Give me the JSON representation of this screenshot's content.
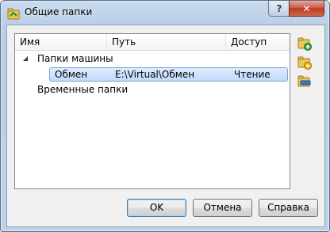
{
  "window": {
    "title": "Общие папки",
    "help_glyph": "?",
    "close_glyph": "✕",
    "title_icon": "shared-folders-icon"
  },
  "list": {
    "columns": [
      "Имя",
      "Путь",
      "Доступ"
    ],
    "group_machine": "Папки машины",
    "expander_glyph": "◢",
    "row": {
      "name": "Обмен",
      "path": "E:\\Virtual\\Обмен",
      "access": "Чтение"
    },
    "group_temp": "Временные папки"
  },
  "side_buttons": [
    {
      "name": "add-folder-icon"
    },
    {
      "name": "edit-folder-icon"
    },
    {
      "name": "remove-folder-icon"
    }
  ],
  "buttons": {
    "ok": "OK",
    "cancel": "Отмена",
    "help": "Справка"
  },
  "colors": {
    "selection": "#c1dbfc",
    "close": "#c9553f"
  }
}
